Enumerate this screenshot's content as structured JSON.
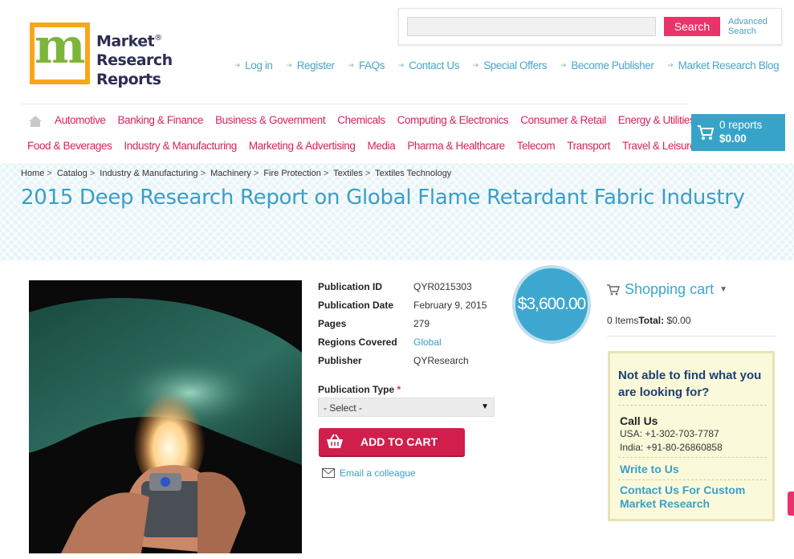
{
  "logo": {
    "line1": "Market",
    "line2": "Research",
    "line3": "Reports",
    "registered": "®"
  },
  "search": {
    "placeholder": "",
    "button": "Search",
    "advanced_line1": "Advanced",
    "advanced_line2": "Search"
  },
  "top_links": [
    "Log in",
    "Register",
    "FAQs",
    "Contact Us",
    "Special Offers",
    "Become Publisher",
    "Market Research Blog"
  ],
  "nav": {
    "row1": [
      "Automotive",
      "Banking & Finance",
      "Business & Government",
      "Chemicals",
      "Computing & Electronics",
      "Consumer & Retail",
      "Energy & Utilities"
    ],
    "row2": [
      "Food & Beverages",
      "Industry & Manufacturing",
      "Marketing & Advertising",
      "Media",
      "Pharma & Healthcare",
      "Telecom",
      "Transport",
      "Travel & Leisure"
    ]
  },
  "cart": {
    "reports": "0 reports",
    "total": "$0.00"
  },
  "breadcrumb": [
    "Home",
    "Catalog",
    "Industry & Manufacturing",
    "Machinery",
    "Fire Protection",
    "Textiles",
    "Textiles Technology"
  ],
  "title": "2015 Deep Research Report on Global Flame Retardant Fabric Industry",
  "details": {
    "publication_id_label": "Publication ID",
    "publication_id": "QYR0215303",
    "publication_date_label": "Publication Date",
    "publication_date": "February 9, 2015",
    "pages_label": "Pages",
    "pages": "279",
    "regions_label": "Regions Covered",
    "regions": "Global",
    "publisher_label": "Publisher",
    "publisher": "QYResearch"
  },
  "price": "$3,600.00",
  "publication_type": {
    "label": "Publication Type",
    "required": "*",
    "selected": "- Select -"
  },
  "add_to_cart": "ADD TO CART",
  "email_colleague": "Email a colleague",
  "shopping_cart": {
    "title": "Shopping cart",
    "items": "0 Items",
    "total_label": "Total:",
    "total": "$0.00"
  },
  "help": {
    "question": "Not able to find what you are looking for?",
    "call_us": "Call Us",
    "usa": "USA: +1-302-703-7787",
    "india": "India: +91-80-26860858",
    "write_to_us": "Write to Us",
    "contact_custom": "Contact Us For Custom Market Research"
  },
  "colors": {
    "accent_pink": "#e8346a",
    "accent_blue": "#3ea7cf",
    "logo_orange": "#f8a71b"
  }
}
